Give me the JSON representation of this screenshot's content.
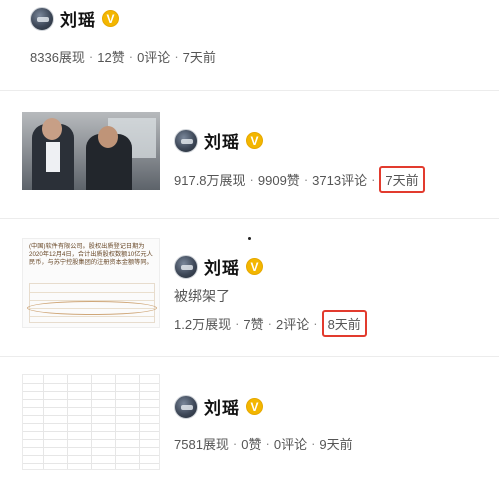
{
  "posts": [
    {
      "author": "刘瑶",
      "verified_icon": "verified-v-icon",
      "stats": {
        "views": "8336展现",
        "likes": "12赞",
        "comments": "0评论",
        "time": "7天前"
      }
    },
    {
      "author": "刘瑶",
      "verified_icon": "verified-v-icon",
      "thumbnail": "photo",
      "stats": {
        "views": "917.8万展现",
        "likes": "9909赞",
        "comments": "3713评论",
        "time": "7天前"
      },
      "time_highlighted": true
    },
    {
      "author": "刘瑶",
      "verified_icon": "verified-v-icon",
      "thumbnail": "document",
      "thumbnail_text": "(中国)软件有限公司。股权出质登记日期为2020年12月4日，合计出质股权数额10亿元人民币，与苏宁控股集团的注册资本金额等同。",
      "text": "被绑架了",
      "stats": {
        "views": "1.2万展现",
        "likes": "7赞",
        "comments": "2评论",
        "time": "8天前"
      },
      "time_highlighted": true
    },
    {
      "author": "刘瑶",
      "verified_icon": "verified-v-icon",
      "thumbnail": "table",
      "stats": {
        "views": "7581展现",
        "likes": "0赞",
        "comments": "0评论",
        "time": "9天前"
      }
    }
  ],
  "separator": "·",
  "verified_mark": "V",
  "colors": {
    "highlight_box": "#e23b2e",
    "verified_badge": "#f3b600",
    "stats_text": "#555555"
  }
}
